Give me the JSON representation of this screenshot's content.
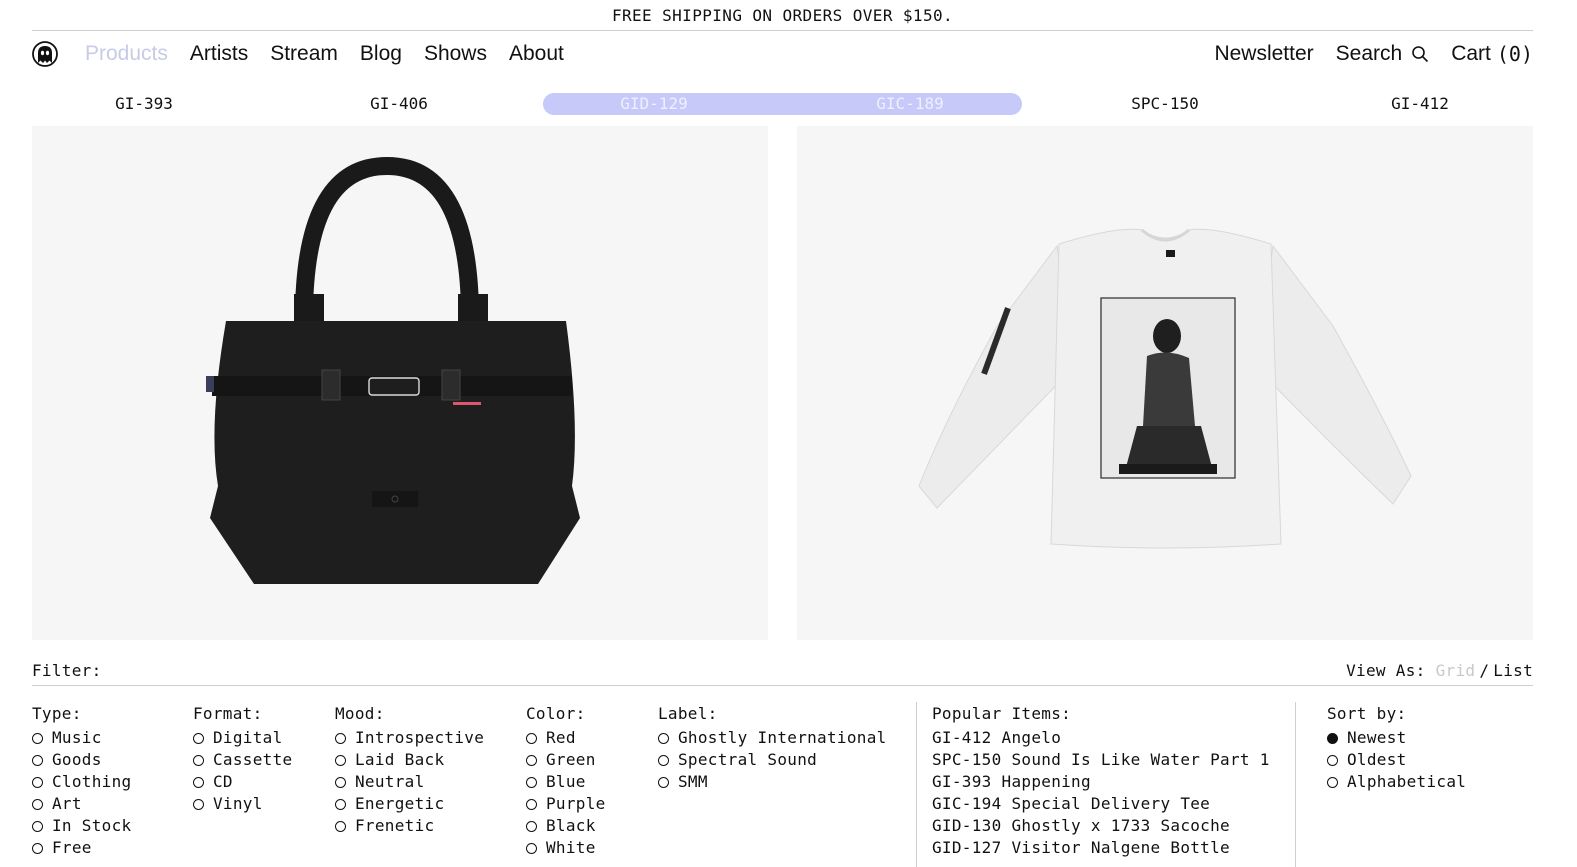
{
  "announcement": "FREE SHIPPING ON ORDERS OVER $150.",
  "nav": {
    "links": [
      "Products",
      "Artists",
      "Stream",
      "Blog",
      "Shows",
      "About"
    ],
    "active": "Products",
    "right": {
      "newsletter": "Newsletter",
      "search": "Search",
      "cart": "Cart",
      "cart_count": "(0)"
    }
  },
  "sku_tabs": [
    "GI-393",
    "GI-406",
    "GID-129",
    "GIC-189",
    "SPC-150",
    "GI-412"
  ],
  "selected_skus": [
    "GID-129",
    "GIC-189"
  ],
  "colors": {
    "accent": "#c7c9f9",
    "active_nav": "#c7cbe8",
    "card_bg": "#f6f6f6"
  },
  "products": [
    {
      "image": "black tote bag"
    },
    {
      "image": "white long sleeve tee"
    }
  ],
  "filter_bar": {
    "label": "Filter:",
    "view_as": "View As:",
    "grid": "Grid",
    "slash": "/",
    "list": "List",
    "view_selected": "List"
  },
  "filters": {
    "type": {
      "label": "Type:",
      "options": [
        "Music",
        "Goods",
        "Clothing",
        "Art",
        "In Stock",
        "Free"
      ]
    },
    "format": {
      "label": "Format:",
      "options": [
        "Digital",
        "Cassette",
        "CD",
        "Vinyl"
      ]
    },
    "mood": {
      "label": "Mood:",
      "options": [
        "Introspective",
        "Laid Back",
        "Neutral",
        "Energetic",
        "Frenetic"
      ]
    },
    "color": {
      "label": "Color:",
      "options": [
        "Red",
        "Green",
        "Blue",
        "Purple",
        "Black",
        "White"
      ]
    },
    "label": {
      "label": "Label:",
      "options": [
        "Ghostly International",
        "Spectral Sound",
        "SMM"
      ]
    }
  },
  "popular": {
    "label": "Popular Items:",
    "items": [
      "GI-412 Angelo",
      "SPC-150 Sound Is Like Water Part 1",
      "GI-393 Happening",
      "GIC-194 Special Delivery Tee",
      "GID-130 Ghostly x 1733 Sacoche",
      "GID-127 Visitor Nalgene Bottle"
    ]
  },
  "sort": {
    "label": "Sort by:",
    "options": [
      "Newest",
      "Oldest",
      "Alphabetical"
    ],
    "selected": "Newest"
  }
}
